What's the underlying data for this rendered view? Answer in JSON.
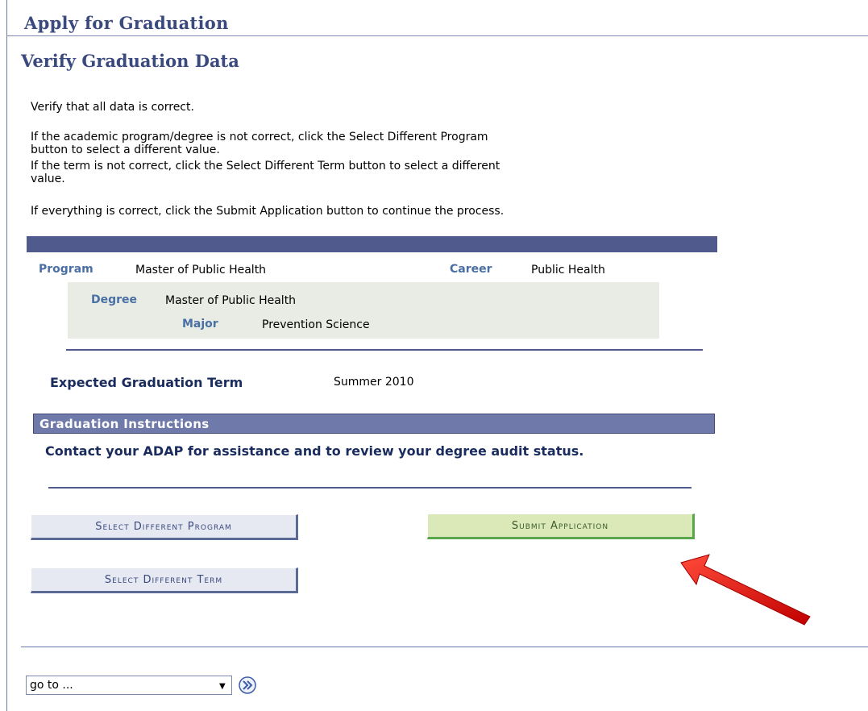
{
  "header": {
    "title": "Apply for Graduation"
  },
  "section": {
    "title": "Verify Graduation Data"
  },
  "instructions": {
    "line1": "Verify that all data is correct.",
    "line2": "If the academic program/degree is not correct, click the Select Different Program",
    "line3": "button to select a different value.",
    "line4": "If the term is not correct, click the Select Different Term button to select a different",
    "line5": "value.",
    "line6": "If everything is correct, click the Submit Application button to continue the process."
  },
  "program": {
    "program_label": "Program",
    "program_value": "Master of Public Health",
    "career_label": "Career",
    "career_value": "Public Health",
    "degree_label": "Degree",
    "degree_value": "Master of Public Health",
    "major_label": "Major",
    "major_value": "Prevention Science"
  },
  "term": {
    "label": "Expected Graduation Term",
    "value": "Summer 2010"
  },
  "graduation_instructions": {
    "header": "Graduation Instructions",
    "text": "Contact your ADAP for assistance and to review your degree audit status."
  },
  "buttons": {
    "select_program": "Select Different Program",
    "submit": "Submit Application",
    "select_term": "Select Different Term"
  },
  "footer": {
    "goto_value": "go to ...",
    "go_icon": "double-chevron-right-icon"
  },
  "colors": {
    "title": "#3b4a7e",
    "bar": "#505a8c",
    "submit_bg": "#dbe8b8",
    "annotation_arrow": "#e02020"
  }
}
